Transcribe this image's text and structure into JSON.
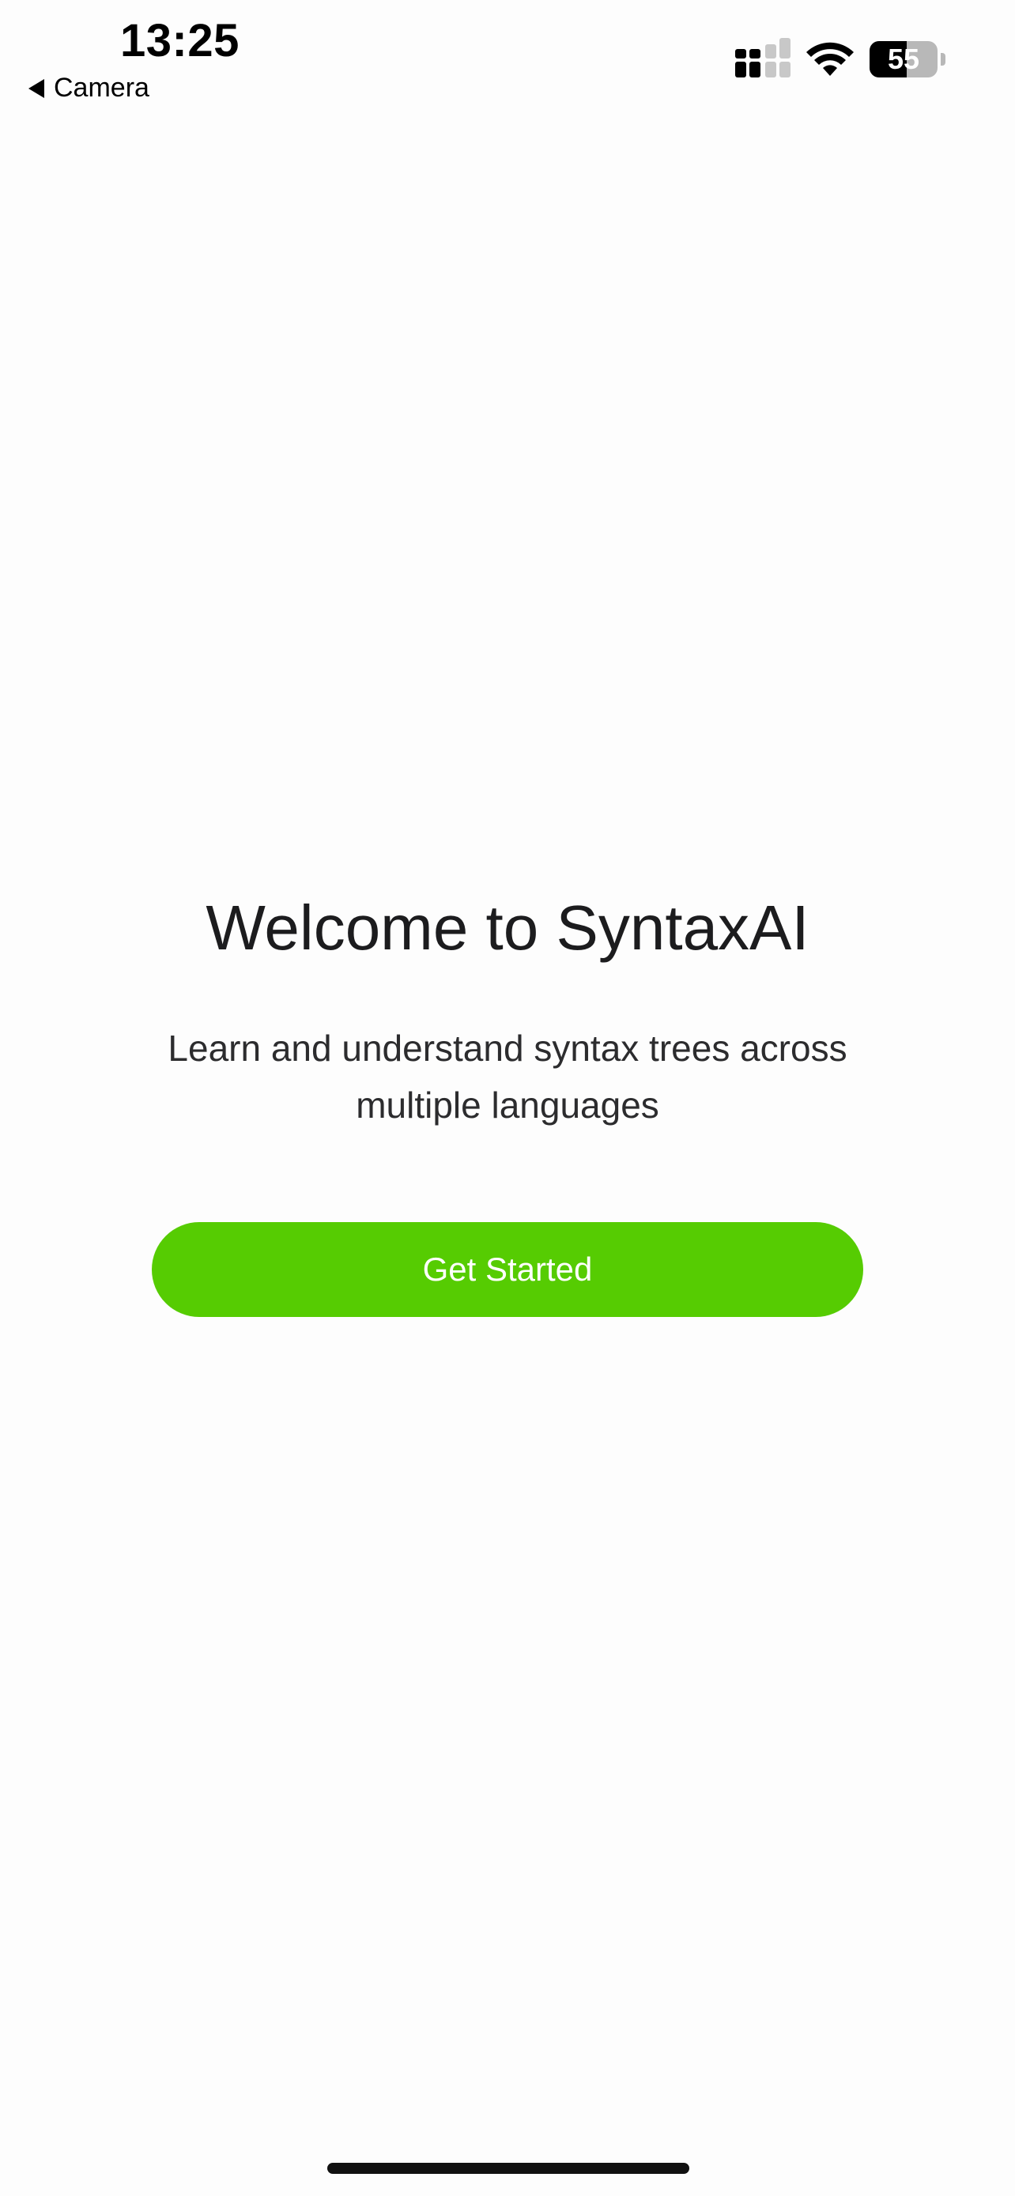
{
  "status_bar": {
    "time": "13:25",
    "back_label": "Camera",
    "battery_level": "55",
    "battery_fraction": 0.55
  },
  "welcome": {
    "title": "Welcome to SyntaxAI",
    "subtitle": "Learn and understand syntax trees across multiple languages",
    "cta_label": "Get Started"
  },
  "colors": {
    "accent": "#56cc02",
    "background": "#fdfdfd",
    "text": "#1c1c1e"
  },
  "icons": {
    "back": "back-arrow-icon",
    "cellular": "cellular-signal-icon",
    "wifi": "wifi-icon",
    "battery": "battery-icon"
  }
}
